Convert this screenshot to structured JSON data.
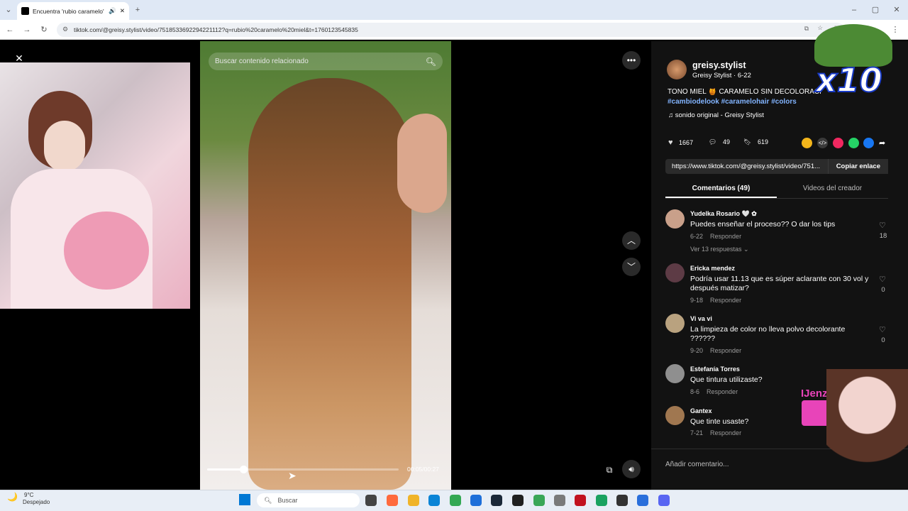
{
  "browser": {
    "tab_title": "Encuentra 'rubio caramelo'",
    "new_tab": "+",
    "url": "tiktok.com/@greisy.stylist/video/7518533692294221112?q=rubio%20caramelo%20miel&t=1760123545835"
  },
  "video": {
    "search_placeholder": "Buscar contenido relacionado",
    "time": "00:05/00:27",
    "progress": 0.19
  },
  "author": {
    "username": "greisy.stylist",
    "display_line": "Greisy Stylist · 6-22",
    "caption": "TONO MIEL 🍯 CARAMELO SIN DECOLORACI",
    "hashtags": [
      "#cambiodelook",
      "#caramelohair",
      "#colors"
    ],
    "sound": "sonido original - Greisy Stylist"
  },
  "stats": {
    "likes": "1667",
    "comments": "49",
    "saves": "619"
  },
  "share": {
    "link": "https://www.tiktok.com/@greisy.stylist/video/751...",
    "copy_label": "Copiar enlace"
  },
  "tabs": {
    "comments": "Comentarios (49)",
    "creator_videos": "Videos del creador"
  },
  "comments": [
    {
      "name": "Yudelka Rosario 🤍 ✿",
      "text": "Puedes enseñar el proceso?? O dar los tips",
      "date": "6-22",
      "reply": "Responder",
      "likes": "18",
      "more": "Ver 13 respuestas ⌄"
    },
    {
      "name": "Ericka mendez",
      "text": "Podría usar 11.13 que es súper aclarante con 30 vol y después matizar?",
      "date": "9-18",
      "reply": "Responder",
      "likes": "0"
    },
    {
      "name": "Vi va vi",
      "text": "La limpieza de color no lleva polvo decolorante ??????",
      "date": "9-20",
      "reply": "Responder",
      "likes": "0"
    },
    {
      "name": "Estefanía Torres",
      "text": "Que tintura utilizaste?",
      "date": "8-6",
      "reply": "Responder"
    },
    {
      "name": "Gantex",
      "text": "Que tinte usaste?",
      "date": "7-21",
      "reply": "Responder"
    }
  ],
  "add_comment": "Añadir comentario...",
  "overlay": {
    "multiplier": "x10",
    "streamer": "IJenz"
  },
  "taskbar": {
    "temp": "9°C",
    "weather": "Despejado",
    "search": "Buscar"
  },
  "colors": {
    "accent_hashtag": "#82b4ff",
    "twitch_pink": "#e844b9"
  }
}
